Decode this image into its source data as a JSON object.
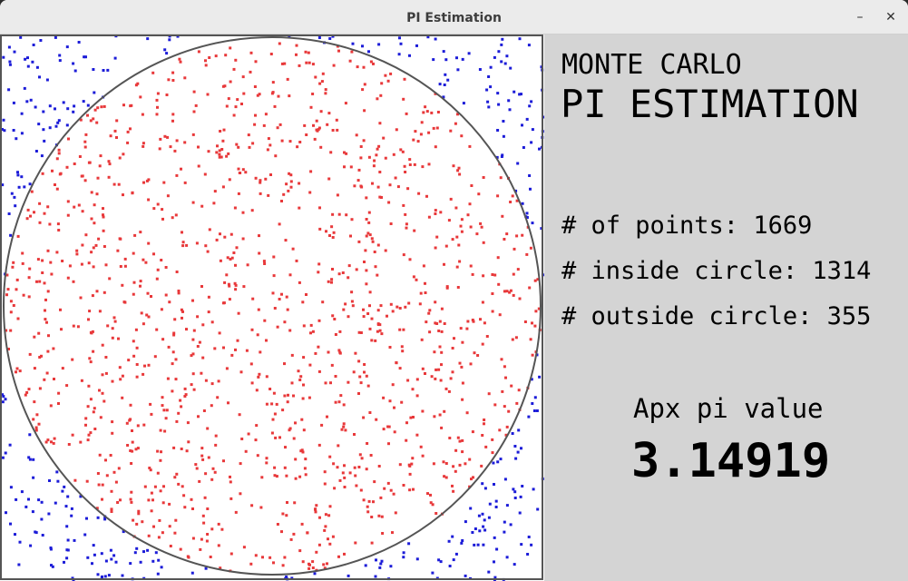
{
  "window": {
    "title": "PI Estimation",
    "minimize_label": "–",
    "close_label": "✕"
  },
  "panel": {
    "heading_line1": "MONTE CARLO",
    "heading_line2": "PI ESTIMATION",
    "stats": [
      {
        "label": "# of points: 1669"
      },
      {
        "label": "# inside circle: 1314"
      },
      {
        "label": "# outside circle: 355"
      }
    ],
    "pi_label": "Apx pi value",
    "pi_value": "3.14919"
  },
  "simulation": {
    "total_points": 1669,
    "inside_points": 1314,
    "outside_points": 355,
    "inside_color": "#e8383a",
    "outside_color": "#1c1cd8",
    "circle_color": "#555555",
    "background_color": "#ffffff"
  }
}
